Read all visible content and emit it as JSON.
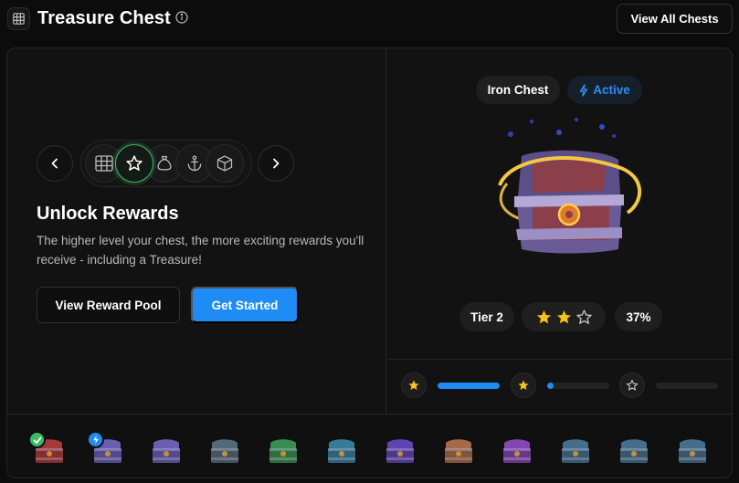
{
  "header": {
    "title": "Treasure Chest",
    "view_all_label": "View All Chests"
  },
  "left": {
    "headline": "Unlock Rewards",
    "description": "The higher level your chest, the more exciting rewards you'll receive - including a Treasure!",
    "view_pool_label": "View Reward Pool",
    "get_started_label": "Get Started",
    "categories": [
      "grid-icon",
      "star-icon",
      "money-bag-icon",
      "anchor-icon",
      "box-icon"
    ],
    "active_category": "star-icon"
  },
  "chest": {
    "name": "Iron Chest",
    "status": "Active",
    "tier": "Tier 2",
    "stars_filled": 2,
    "stars_total": 3,
    "progress": "37%"
  },
  "progress": {
    "segments": [
      {
        "star": "filled",
        "fill": 1.0
      },
      {
        "star": "filled",
        "fill": 0.1
      },
      {
        "star": "empty",
        "fill": 0.0
      }
    ]
  },
  "strip": {
    "chests": [
      {
        "color": "#c0413e",
        "badge": "check"
      },
      {
        "color": "#7a6cd0",
        "badge": "bolt"
      },
      {
        "color": "#7a6cd0",
        "badge": ""
      },
      {
        "color": "#5f7a8c",
        "badge": ""
      },
      {
        "color": "#3ea35a",
        "badge": ""
      },
      {
        "color": "#3d8fb0",
        "badge": ""
      },
      {
        "color": "#6d4fd0",
        "badge": ""
      },
      {
        "color": "#c07a50",
        "badge": ""
      },
      {
        "color": "#9a4fd0",
        "badge": ""
      },
      {
        "color": "#4f7fa0",
        "badge": ""
      },
      {
        "color": "#4f7fa0",
        "badge": ""
      },
      {
        "color": "#4f7fa0",
        "badge": ""
      }
    ]
  },
  "colors": {
    "accent": "#1f8bf5",
    "active_green": "#3dbb63",
    "star_gold": "#f5c518"
  }
}
